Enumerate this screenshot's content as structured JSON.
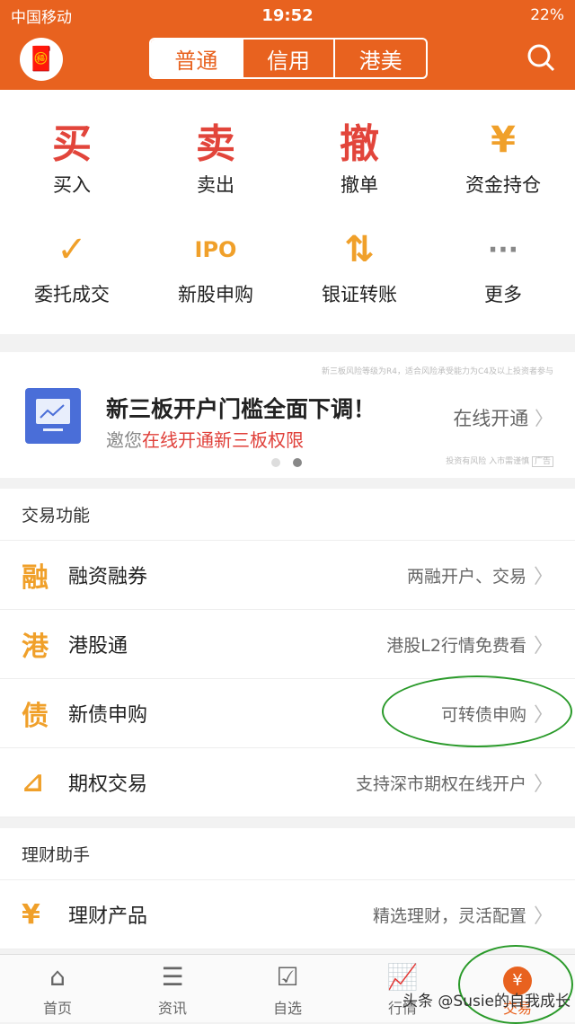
{
  "status": {
    "carrier": "中国移动",
    "time": "19:52",
    "battery": "22%"
  },
  "header": {
    "tabs": [
      "普通",
      "信用",
      "港美"
    ],
    "active": 0
  },
  "actions": [
    {
      "icon": "买",
      "label": "买入"
    },
    {
      "icon": "卖",
      "label": "卖出"
    },
    {
      "icon": "撤",
      "label": "撤单"
    },
    {
      "icon": "¥",
      "label": "资金持仓"
    },
    {
      "icon": "✓",
      "label": "委托成交"
    },
    {
      "icon": "IPO",
      "label": "新股申购"
    },
    {
      "icon": "⇅",
      "label": "银证转账"
    },
    {
      "icon": "···",
      "label": "更多"
    }
  ],
  "banner": {
    "notice": "新三板风险等级为R4，适合风险承受能力为C4及以上投资者参与",
    "title": "新三板开户门槛全面下调！",
    "sub_prefix": "邀您",
    "sub_highlight": "在线开通新三板权限",
    "cta": "在线开通",
    "disclaimer": "投资有风险 入市需谨慎",
    "ad": "广告"
  },
  "trade": {
    "title": "交易功能",
    "rows": [
      {
        "icon": "融",
        "label": "融资融券",
        "right": "两融开户、交易"
      },
      {
        "icon": "港",
        "label": "港股通",
        "right": "港股L2行情免费看"
      },
      {
        "icon": "债",
        "label": "新债申购",
        "right": "可转债申购"
      },
      {
        "icon": "⊿",
        "label": "期权交易",
        "right": "支持深市期权在线开户"
      }
    ]
  },
  "finance": {
    "title": "理财助手",
    "rows": [
      {
        "icon": "¥",
        "label": "理财产品",
        "right": "精选理财，灵活配置"
      }
    ]
  },
  "tabbar": [
    {
      "icon": "⌂",
      "label": "首页"
    },
    {
      "icon": "☰",
      "label": "资讯"
    },
    {
      "icon": "☑",
      "label": "自选"
    },
    {
      "icon": "📈",
      "label": "行情"
    },
    {
      "icon": "¥",
      "label": "交易"
    }
  ],
  "watermark": "头条 @Susie的自我成长",
  "colors": {
    "brand": "#E8621F",
    "accent_red": "#E2453B",
    "icon_orange": "#F0A02A",
    "annotation": "#2a9a2a"
  }
}
